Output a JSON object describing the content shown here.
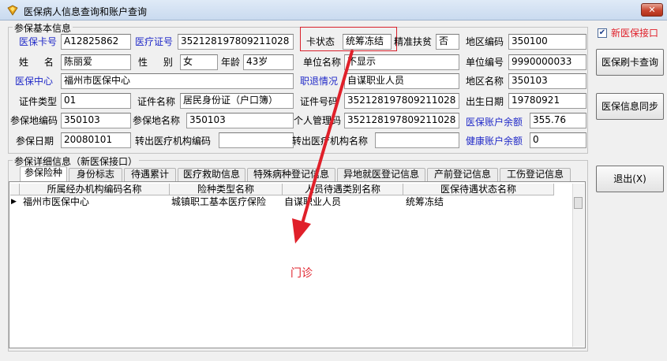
{
  "window": {
    "title": "医保病人信息查询和账户查询",
    "close_label": "✕"
  },
  "basic": {
    "group_title": "参保基本信息",
    "card_no_label": "医保卡号",
    "card_no": "A12825862",
    "medical_id_label": "医疗证号",
    "medical_id": "352128197809211028",
    "card_status_label": "卡状态",
    "card_status": "统筹冻结",
    "poverty_label": "精准扶贫",
    "poverty": "否",
    "region_code_label": "地区编码",
    "region_code": "350100",
    "name_label": "姓 名",
    "name": "陈丽爱",
    "gender_label": "性 别",
    "gender": "女",
    "age_label": "年龄",
    "age": "43岁",
    "unit_name_label": "单位名称",
    "unit_name": "不显示",
    "unit_no_label": "单位编号",
    "unit_no": "9990000033",
    "center_label": "医保中心",
    "center": "福州市医保中心",
    "job_status_label": "职退情况",
    "job_status": "自谋职业人员",
    "region_name_label": "地区名称",
    "region_name": "350103",
    "cert_type_label": "证件类型",
    "cert_type": "01",
    "cert_name_label": "证件名称",
    "cert_name": "居民身份证（户口簿）",
    "cert_no_label": "证件号码",
    "cert_no": "352128197809211028",
    "birth_label": "出生日期",
    "birth": "19780921",
    "ins_code_label": "参保地编码",
    "ins_code": "350103",
    "ins_name_label": "参保地名称",
    "ins_name": "350103",
    "personal_code_label": "个人管理码",
    "personal_code": "352128197809211028",
    "account_balance_label": "医保账户余额",
    "account_balance": "355.76",
    "ins_date_label": "参保日期",
    "ins_date": "20080101",
    "out_code_label": "转出医疗机构编码",
    "out_code": "",
    "out_name_label": "转出医疗机构名称",
    "out_name": "",
    "health_balance_label": "健康账户余额",
    "health_balance": "0"
  },
  "detail": {
    "group_title": "参保详细信息（新医保接口）",
    "tabs": [
      "参保险种",
      "身份标志",
      "待遇累计",
      "医疗救助信息",
      "特殊病种登记信息",
      "异地就医登记信息",
      "产前登记信息",
      "工伤登记信息"
    ],
    "columns": [
      "所属经办机构编码名称",
      "险种类型名称",
      "人员待遇类别名称",
      "医保待遇状态名称"
    ],
    "rows": [
      [
        "福州市医保中心",
        "城镇职工基本医疗保险",
        "自谋职业人员",
        "统筹冻结"
      ]
    ],
    "row_marker": "▶"
  },
  "side": {
    "new_interface_label": "新医保接口",
    "new_interface_checked": true,
    "check_mark": "✔",
    "card_query_label": "医保刷卡查询",
    "sync_label": "医保信息同步",
    "exit_label": "退出(X)"
  },
  "annotation": {
    "text": "门诊",
    "color": "#e0202a"
  }
}
